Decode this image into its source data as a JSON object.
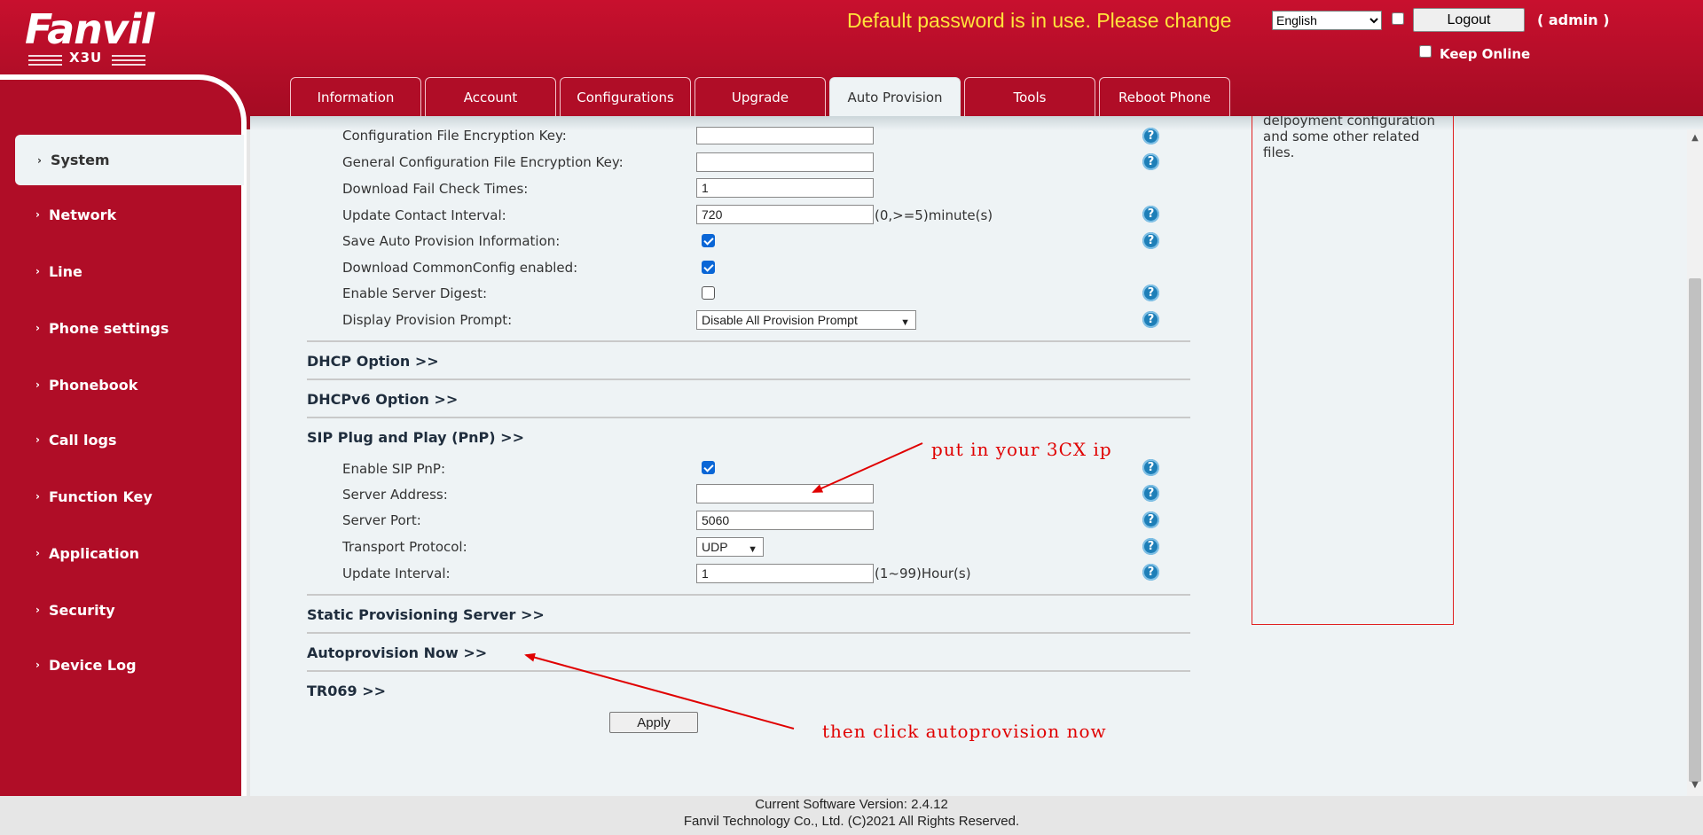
{
  "header": {
    "brand": "Fanvil",
    "model": "X3U",
    "password_warning": "Default password is in use. Please change",
    "language_selected": "English",
    "logout_label": "Logout",
    "user_label": "( admin )",
    "keep_online_label": "Keep Online"
  },
  "tabs": [
    {
      "label": "Information"
    },
    {
      "label": "Account"
    },
    {
      "label": "Configurations"
    },
    {
      "label": "Upgrade"
    },
    {
      "label": "Auto Provision",
      "active": true
    },
    {
      "label": "Tools"
    },
    {
      "label": "Reboot Phone"
    }
  ],
  "sidebar": {
    "items": [
      {
        "label": "System",
        "active": true
      },
      {
        "label": "Network"
      },
      {
        "label": "Line"
      },
      {
        "label": "Phone settings"
      },
      {
        "label": "Phonebook"
      },
      {
        "label": "Call logs"
      },
      {
        "label": "Function Key"
      },
      {
        "label": "Application"
      },
      {
        "label": "Security"
      },
      {
        "label": "Device Log"
      }
    ]
  },
  "form": {
    "config_key_label": "Configuration File Encryption Key:",
    "config_key_value": "",
    "general_key_label": "General Configuration File Encryption Key:",
    "general_key_value": "",
    "fail_check_label": "Download Fail Check Times:",
    "fail_check_value": "1",
    "update_contact_label": "Update Contact Interval:",
    "update_contact_value": "720",
    "update_contact_unit": "(0,>=5)minute(s)",
    "save_info_label": "Save Auto Provision Information:",
    "save_info_checked": true,
    "download_common_label": "Download CommonConfig enabled:",
    "download_common_checked": true,
    "server_digest_label": "Enable Server Digest:",
    "server_digest_checked": false,
    "display_prompt_label": "Display Provision Prompt:",
    "display_prompt_value": "Disable All Provision Prompt"
  },
  "sections": {
    "dhcp": "DHCP Option >>",
    "dhcpv6": "DHCPv6 Option >>",
    "sip_pnp": "SIP Plug and Play (PnP) >>",
    "static_server": "Static Provisioning Server >>",
    "autoprovision_now": "Autoprovision Now >>",
    "tr069": "TR069 >>"
  },
  "pnp": {
    "enable_label": "Enable SIP PnP:",
    "enable_checked": true,
    "server_address_label": "Server Address:",
    "server_address_value": "",
    "server_port_label": "Server Port:",
    "server_port_value": "5060",
    "transport_label": "Transport Protocol:",
    "transport_value": "UDP",
    "update_interval_label": "Update Interval:",
    "update_interval_value": "1",
    "update_interval_unit": "(1~99)Hour(s)"
  },
  "apply_label": "Apply",
  "help_box": {
    "text_cut": "delpoyment configuration",
    "text": "and some other related files."
  },
  "annotations": {
    "put_ip": "put in your 3CX ip",
    "click_now": "then click autoprovision now"
  },
  "footer": {
    "version": "Current Software Version: 2.4.12",
    "copyright": "Fanvil Technology Co., Ltd. (C)2021 All Rights Reserved."
  },
  "colors": {
    "brand_red": "#b00d27",
    "warning_yellow": "#ffe33b",
    "panel_bg": "#eef3f5",
    "help_blue": "#1e7fb8",
    "annotation_red": "#e00000"
  }
}
